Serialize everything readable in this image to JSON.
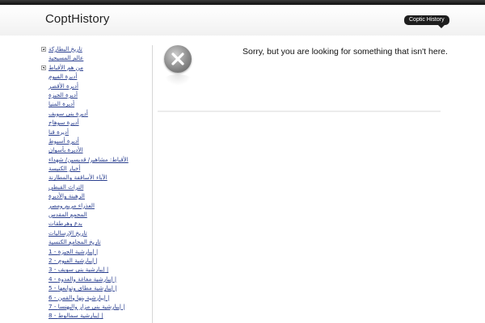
{
  "site": {
    "title": "CoptHistory",
    "tag_label": "Coptic History"
  },
  "sidebar": {
    "items": [
      {
        "label": "تاريخ البطاركة",
        "expander": true
      },
      {
        "label": "عالم المسيحية",
        "expander": false
      },
      {
        "label": "من هم الأقباط",
        "expander": true
      },
      {
        "label": "أديرة الفيوم",
        "expander": false
      },
      {
        "label": "أديرة الأقصر",
        "expander": false
      },
      {
        "label": "أديرة الجيزة",
        "expander": false
      },
      {
        "label": "أديرة المنيا",
        "expander": false
      },
      {
        "label": "أديرة بنى سويف",
        "expander": false
      },
      {
        "label": "أديرة سوهاج",
        "expander": false
      },
      {
        "label": "أديرة قنا",
        "expander": false
      },
      {
        "label": "أديرة أسيوط",
        "expander": false
      },
      {
        "label": "الأديرة بأسوان",
        "expander": false
      },
      {
        "label": "الأقباط: مشاهير/ قديسين/ شهداء",
        "expander": false
      },
      {
        "label": "أخبار الكنيسة",
        "expander": false
      },
      {
        "label": "الآباء الأساقفة والمطارنة",
        "expander": false
      },
      {
        "label": "التراث القبطي",
        "expander": false
      },
      {
        "label": "الرهبنة والأديرة",
        "expander": false
      },
      {
        "label": "العذراء مريم ومصر",
        "expander": false
      },
      {
        "label": "المجمع المقدس",
        "expander": false
      },
      {
        "label": "بدع وهرطقات",
        "expander": false
      },
      {
        "label": "تاريخ الإرساليات",
        "expander": false
      },
      {
        "label": "تاريخ المجامع الكنسية",
        "expander": false
      },
      {
        "label": "1 - إيبارشية الجيزة |",
        "expander": false
      },
      {
        "label": "2 - إيبارشية الفيوم |",
        "expander": false
      },
      {
        "label": "3 - إيبارشية بنى سويف |",
        "expander": false
      },
      {
        "label": "4 - إيبارشية مغاغة والعدوة |",
        "expander": false
      },
      {
        "label": "5 - إيبارشية مطاى وتوابعها |",
        "expander": false
      },
      {
        "label": "6 - إيبارشية بنها والقمن |",
        "expander": false
      },
      {
        "label": "7 - إيبارشية بنى مزار والبهنسا |",
        "expander": false
      },
      {
        "label": "8 - إيبارشية سمالوط |",
        "expander": false
      }
    ]
  },
  "main": {
    "message": "Sorry, but you are looking for something that isn't here.",
    "icon": "error-x-icon"
  }
}
